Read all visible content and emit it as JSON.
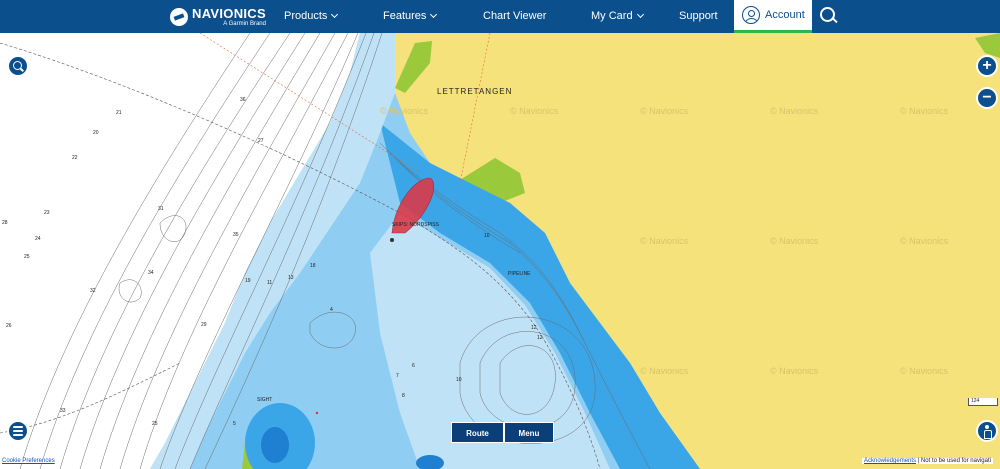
{
  "nav": {
    "brand_name": "NAVIONICS",
    "brand_sub": "A Garmin Brand",
    "items": [
      {
        "label": "Products",
        "has_menu": true
      },
      {
        "label": "Features",
        "has_menu": true
      },
      {
        "label": "Chart Viewer",
        "has_menu": false
      },
      {
        "label": "My Card",
        "has_menu": true
      },
      {
        "label": "Support",
        "has_menu": false
      }
    ],
    "account_label": "Account",
    "accent_color": "#0b4f8c",
    "active_color": "#2fb54b"
  },
  "map": {
    "place_name": "LETTRETANGEN",
    "watermark_text": "© Navionics",
    "area_label": "SKIPS: NORDSPISS",
    "pipeline_label": "PIPELINE",
    "light_label": "SIGHT",
    "depths": [
      "21",
      "20",
      "22",
      "23",
      "24",
      "25",
      "27",
      "28",
      "31",
      "32",
      "33",
      "34",
      "26",
      "10",
      "12",
      "12",
      "10",
      "6",
      "4",
      "7",
      "8",
      "5",
      "11",
      "13",
      "18",
      "19",
      "29",
      "35",
      "36",
      "25"
    ],
    "colors": {
      "land": "#f6e27a",
      "deep": "#3aa6e8",
      "shallow": "#bfe2f7",
      "mid": "#8fcdf2",
      "wood": "#9ac93c",
      "white": "#ffffff"
    },
    "scale_label": "124"
  },
  "controls": {
    "search_icon": "search-icon",
    "zoom_in": "+",
    "zoom_out": "−",
    "route_label": "Route",
    "menu_label": "Menu",
    "layers_icon": "layers-icon",
    "profile_icon": "person-icon"
  },
  "footer": {
    "cookie_label": "Cookie Preferences",
    "ack_label": "Acknowledgements",
    "disclaimer": "| Not to be used for navigati"
  }
}
